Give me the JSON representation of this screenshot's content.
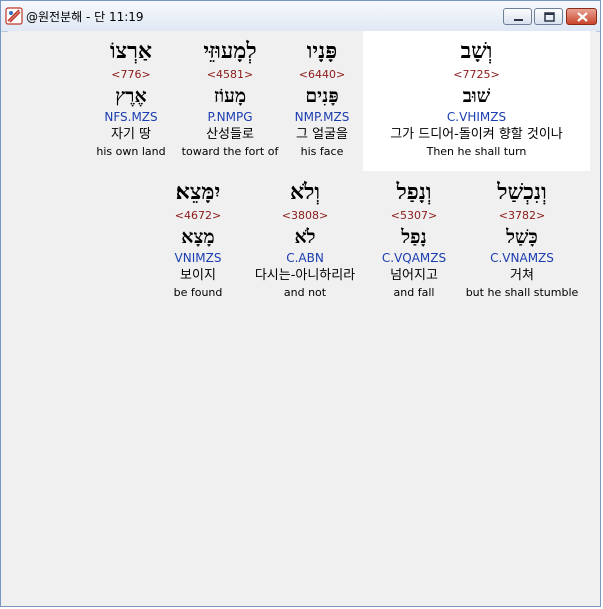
{
  "window": {
    "title": "@원전분해 - 단 11:19",
    "buttons": {
      "minimize": "minimize-icon",
      "maximize": "maximize-icon",
      "close": "close-icon"
    }
  },
  "colors": {
    "strong_number": "#8b1a1a",
    "morphology": "#1a3db0",
    "highlight": "#ffffff"
  },
  "rows": [
    {
      "words": [
        {
          "hebrew": "וְשָׁב",
          "strong": "<7725>",
          "lemma": "שׁוּב",
          "morph": "C.VHIMZS",
          "korean": "그가 드디어-돌이켜 향할 것이나",
          "english": "Then he shall turn",
          "highlighted": true
        },
        {
          "hebrew": "פָּנָיו",
          "strong": "<6440>",
          "lemma": "פָּנִים",
          "morph": "NMP.MZS",
          "korean": "그 얼굴을",
          "english": "his face",
          "highlighted": false
        },
        {
          "hebrew": "לְמָעוּזֵּי",
          "strong": "<4581>",
          "lemma": "מָעוֹז",
          "morph": "P.NMPG",
          "korean": "산성들로",
          "english": "toward the fort of",
          "highlighted": false
        },
        {
          "hebrew": "אַרְצוֹ",
          "strong": "<776>",
          "lemma": "אֶרֶץ",
          "morph": "NFS.MZS",
          "korean": "자기 땅",
          "english": "his own land",
          "highlighted": false
        }
      ]
    },
    {
      "words": [
        {
          "hebrew": "וְנִכְשַׁל",
          "strong": "<3782>",
          "lemma": "כָּשַׁל",
          "morph": "C.VNAMZS",
          "korean": "거쳐",
          "english": "but he shall stumble",
          "highlighted": false
        },
        {
          "hebrew": "וְנָפַל",
          "strong": "<5307>",
          "lemma": "נָפַל",
          "morph": "C.VQAMZS",
          "korean": "넘어지고",
          "english": "and fall",
          "highlighted": false
        },
        {
          "hebrew": "וְלֹא",
          "strong": "<3808>",
          "lemma": "לֹא",
          "morph": "C.ABN",
          "korean": "다시는-아니하리라",
          "english": "and not",
          "highlighted": false
        },
        {
          "hebrew": "יִמָּצֵא׃",
          "strong": "<4672>",
          "lemma": "מָצָא",
          "morph": "VNIMZS",
          "korean": "보이지",
          "english": "be found",
          "highlighted": false
        }
      ]
    }
  ]
}
